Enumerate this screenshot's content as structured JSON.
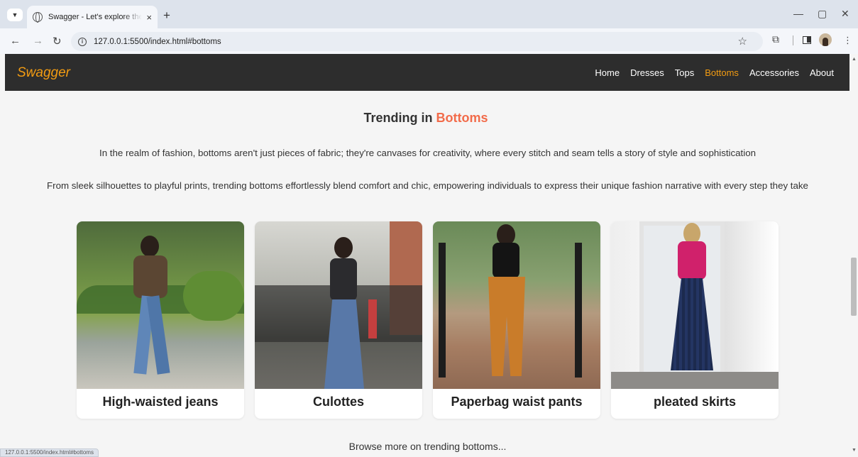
{
  "browser": {
    "tab_title": "Swagger - Let's explore the trend",
    "tab_close": "×",
    "new_tab": "+",
    "url": "127.0.0.1:5500/index.html#bottoms",
    "status_url": "127.0.0.1:5500/index.html#bottoms",
    "controls": {
      "minimize": "—",
      "restore": "▢",
      "close": "✕"
    }
  },
  "site": {
    "brand": "Swagger",
    "brand_color": "#f39c12",
    "accent_color": "#f26b4a",
    "nav": [
      "Home",
      "Dresses",
      "Tops",
      "Bottoms",
      "Accessories",
      "About"
    ],
    "active_nav": "Bottoms"
  },
  "section": {
    "heading_prefix": "Trending in",
    "heading_accent": "Bottoms",
    "para1": "In the realm of fashion, bottoms aren't just pieces of fabric; they're canvases for creativity, where every stitch and seam tells a story of style and sophistication",
    "para2": "From sleek silhouettes to playful prints, trending bottoms effortlessly blend comfort and chic, empowering individuals to express their unique fashion narrative with every step they take",
    "cards": [
      {
        "caption": "High-waisted jeans"
      },
      {
        "caption": "Culottes"
      },
      {
        "caption": "Paperbag waist pants"
      },
      {
        "caption": "pleated skirts"
      }
    ],
    "footer_link": "Browse more on trending bottoms..."
  },
  "icons": [
    "tab-search-icon",
    "globe-icon",
    "back-icon",
    "forward-icon",
    "reload-icon",
    "info-icon",
    "star-icon",
    "extensions-icon",
    "side-panel-icon",
    "profile-icon",
    "menu-icon"
  ]
}
